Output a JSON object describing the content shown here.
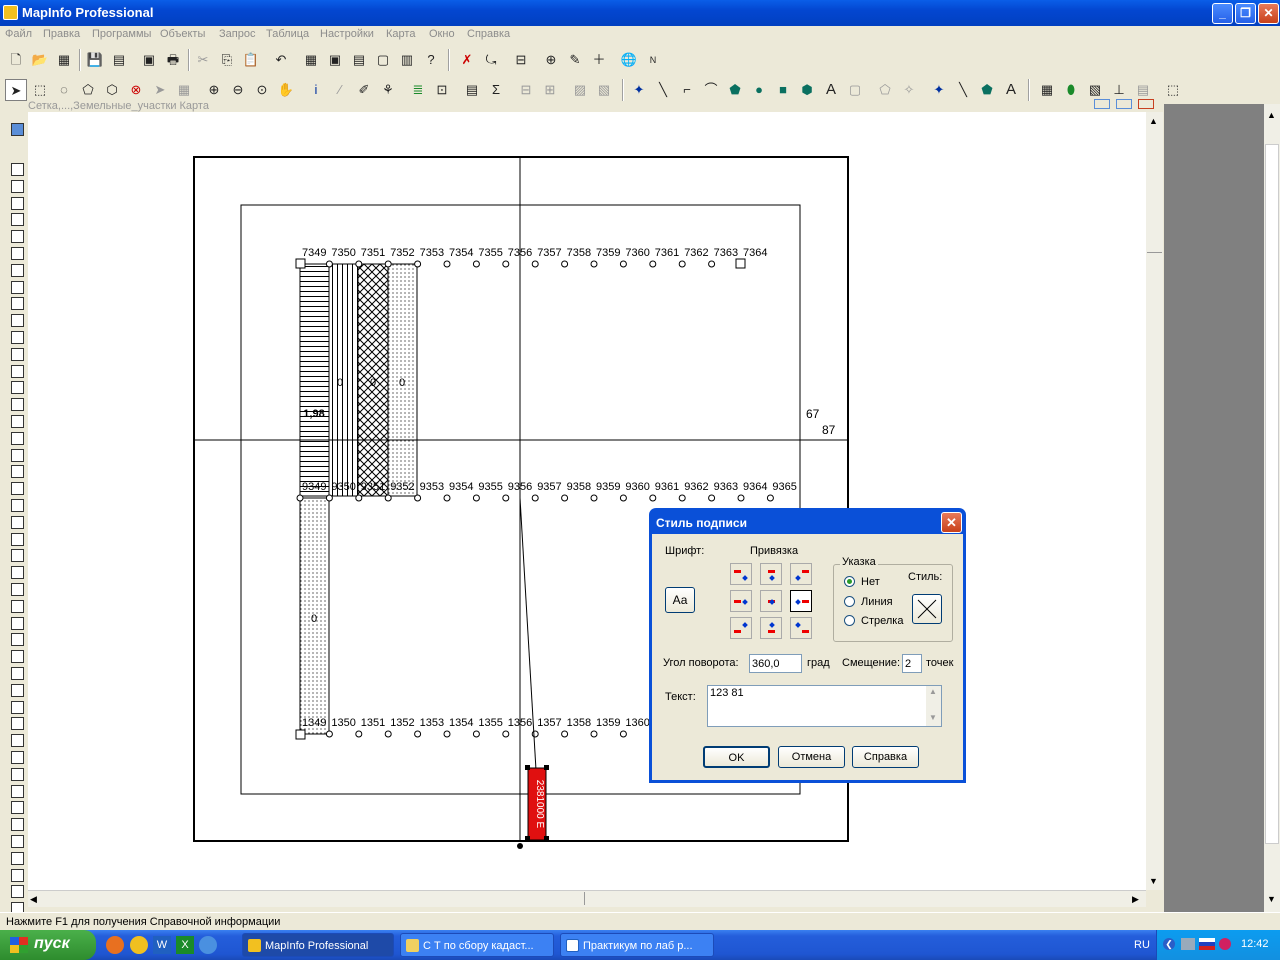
{
  "window": {
    "title": "MapInfo Professional"
  },
  "menu": [
    "Файл",
    "Правка",
    "Программы",
    "Объекты",
    "Запрос",
    "Таблица",
    "Настройки",
    "Карта",
    "Окно",
    "Справка"
  ],
  "map_window": {
    "title": "Сетка,...,Земельные_участки Карта"
  },
  "map": {
    "top_row_labels": [
      "7349",
      "7350",
      "7351",
      "7352",
      "7353",
      "7354",
      "7355",
      "7356",
      "7357",
      "7358",
      "7359",
      "7360",
      "7361",
      "7362",
      "7363",
      "7364"
    ],
    "mid_row_labels": [
      "9349",
      "9350",
      "9351",
      "9352",
      "9353",
      "9354",
      "9355",
      "9356",
      "9357",
      "9358",
      "9359",
      "9360",
      "9361",
      "9362",
      "9363",
      "9364",
      "9365"
    ],
    "bottom_row_labels": [
      "1349",
      "1350",
      "1351",
      "1352",
      "1353",
      "1354",
      "1355",
      "1356",
      "1357",
      "1358",
      "1359",
      "1360"
    ],
    "parcel_values": [
      "0",
      "0",
      "0",
      "1,98",
      "0"
    ],
    "side_labels": [
      "67",
      "87"
    ],
    "callout_text": "2381000 E"
  },
  "dialog": {
    "title": "Стиль подписи",
    "font_label": "Шрифт:",
    "font_button": "Аа",
    "anchor_label": "Привязка",
    "pointer_group": "Указка",
    "pointer_options": [
      "Нет",
      "Линия",
      "Стрелка"
    ],
    "pointer_selected": "Нет",
    "style_label": "Стиль:",
    "rotation_label": "Угол поворота:",
    "rotation_value": "360,0",
    "rotation_unit": "град",
    "offset_label": "Смещение:",
    "offset_value": "2",
    "offset_unit": "точек",
    "text_label": "Текст:",
    "text_value": "123  81",
    "ok": "OK",
    "cancel": "Отмена",
    "help": "Справка"
  },
  "status_text": "Нажмите F1 для получения Справочной информации",
  "taskbar": {
    "start": "пуск",
    "tasks": [
      "MapInfo Professional",
      "С Т по сбору кадаст...",
      "Практикум по лаб р..."
    ],
    "lang": "RU",
    "clock": "12:42"
  }
}
